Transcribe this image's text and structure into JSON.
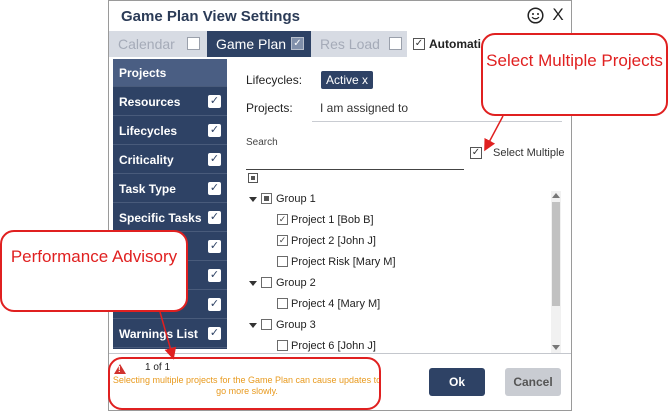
{
  "dialog": {
    "title": "Game Plan View Settings",
    "icons": {
      "feedback": "smiley-icon",
      "close": "close-icon"
    },
    "close_label": "X"
  },
  "tabs": [
    {
      "label": "Calendar",
      "checked": false,
      "active": false
    },
    {
      "label": "Game Plan",
      "checked": true,
      "active": true
    },
    {
      "label": "Res Load",
      "checked": false,
      "active": false
    },
    {
      "label": "Automatic",
      "checked": true,
      "active": false
    }
  ],
  "sidebar": {
    "items": [
      {
        "label": "Projects",
        "checked": false,
        "active": true
      },
      {
        "label": "Resources",
        "checked": true
      },
      {
        "label": "Lifecycles",
        "checked": true
      },
      {
        "label": "Criticality",
        "checked": true
      },
      {
        "label": "Task Type",
        "checked": true
      },
      {
        "label": "Specific Tasks",
        "checked": true
      },
      {
        "label": "",
        "checked": true
      },
      {
        "label": "",
        "checked": true
      },
      {
        "label": "",
        "checked": true
      },
      {
        "label": "Warnings List",
        "checked": true
      }
    ]
  },
  "filters": {
    "lifecycles_label": "Lifecycles:",
    "lifecycles_chip": "Active x",
    "projects_label": "Projects:",
    "projects_value": "I am assigned to",
    "search_label": "Search",
    "search_value": "",
    "select_multiple_label": "Select Multiple",
    "select_multiple_checked": true
  },
  "tree": [
    {
      "type": "group",
      "label": "Group 1",
      "state": "partial"
    },
    {
      "type": "project",
      "label": "Project 1 [Bob B]",
      "checked": true
    },
    {
      "type": "project",
      "label": "Project 2 [John J]",
      "checked": true
    },
    {
      "type": "project",
      "label": "Project Risk [Mary M]",
      "checked": false
    },
    {
      "type": "group",
      "label": "Group 2",
      "state": "unchecked"
    },
    {
      "type": "project",
      "label": "Project 4 [Mary M]",
      "checked": false
    },
    {
      "type": "group",
      "label": "Group 3",
      "state": "unchecked"
    },
    {
      "type": "project",
      "label": "Project 6 [John J]",
      "checked": false
    }
  ],
  "footer": {
    "page_count": "1 of 1",
    "warning": "Selecting multiple projects for the Game Plan can cause updates to go more slowly.",
    "ok_label": "Ok",
    "cancel_label": "Cancel"
  },
  "callouts": {
    "select_multiple": "Select Multiple Projects",
    "performance": "Performance Advisory"
  },
  "colors": {
    "navy": "#2e4265",
    "callout_red": "#e02020",
    "warning_orange": "#e89a1e"
  }
}
